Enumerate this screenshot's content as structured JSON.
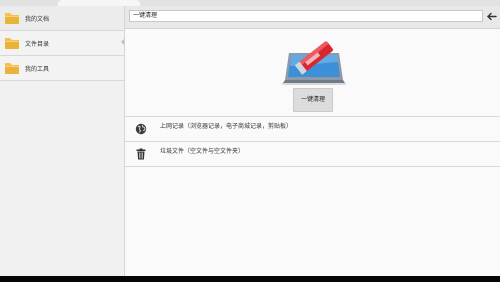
{
  "sidebar": {
    "items": [
      {
        "label": "我的文档",
        "icon": "folder-icon"
      },
      {
        "label": "文件目录",
        "icon": "folder-icon"
      },
      {
        "label": "我的工具",
        "icon": "folder-icon"
      }
    ]
  },
  "toolbar": {
    "search_value": "一键清理",
    "back_icon": "back-arrow-icon"
  },
  "hero": {
    "icon": "eraser-laptop-icon",
    "button_label": "一键清理"
  },
  "list": {
    "items": [
      {
        "label": "上网记录（浏览器记录，电子商城记录，剪贴板）",
        "icon": "globe-icon"
      },
      {
        "label": "垃圾文件（空文件与空文件夹）",
        "icon": "trash-icon"
      }
    ]
  },
  "colors": {
    "folder": "#f0b43a",
    "eraser": "#d7282f",
    "screen": "#3d8fd8",
    "background": "#fafafa"
  }
}
